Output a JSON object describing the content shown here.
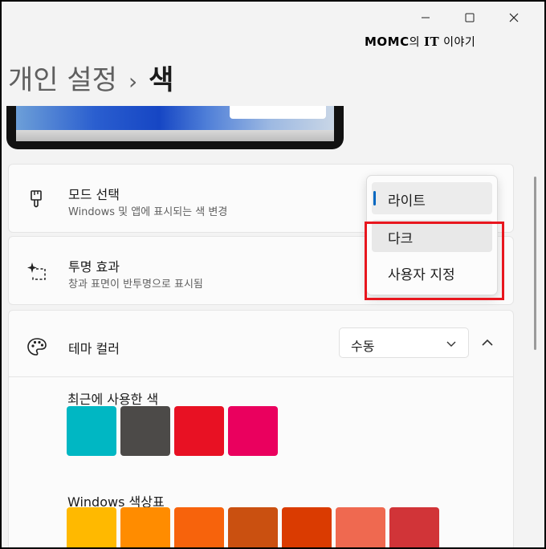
{
  "window": {
    "controls": {
      "minimize": "minimize-icon",
      "maximize": "maximize-icon",
      "close": "close-icon"
    }
  },
  "watermark": {
    "part1": "MOMC",
    "part2": "의 ",
    "part3": "IT",
    "part4": " 이야기"
  },
  "breadcrumb": {
    "parent": "개인 설정",
    "separator": "›",
    "current": "색"
  },
  "mode": {
    "icon": "brush-icon",
    "title": "모드 선택",
    "description": "Windows 및 앱에 표시되는 색 변경",
    "options": [
      "라이트",
      "다크",
      "사용자 지정"
    ],
    "selected": "라이트"
  },
  "transparency": {
    "icon": "sparkle-icon",
    "title": "투명 효과",
    "description": "창과 표면이 반투명으로 표시됨"
  },
  "theme_color": {
    "icon": "palette-icon",
    "title": "테마 컬러",
    "dropdown_value": "수동",
    "recent_label": "최근에 사용한 색",
    "recent_colors": [
      "#00b7c3",
      "#4c4a48",
      "#e81123",
      "#ea005e"
    ],
    "palette_label": "Windows 색상표",
    "palette_colors": [
      "#ffb900",
      "#ff8c00",
      "#f7630c",
      "#ca5010",
      "#da3b01",
      "#ef6950",
      "#d13438"
    ]
  },
  "accent_color": "#0067c0",
  "highlight_color": "#e8161e"
}
